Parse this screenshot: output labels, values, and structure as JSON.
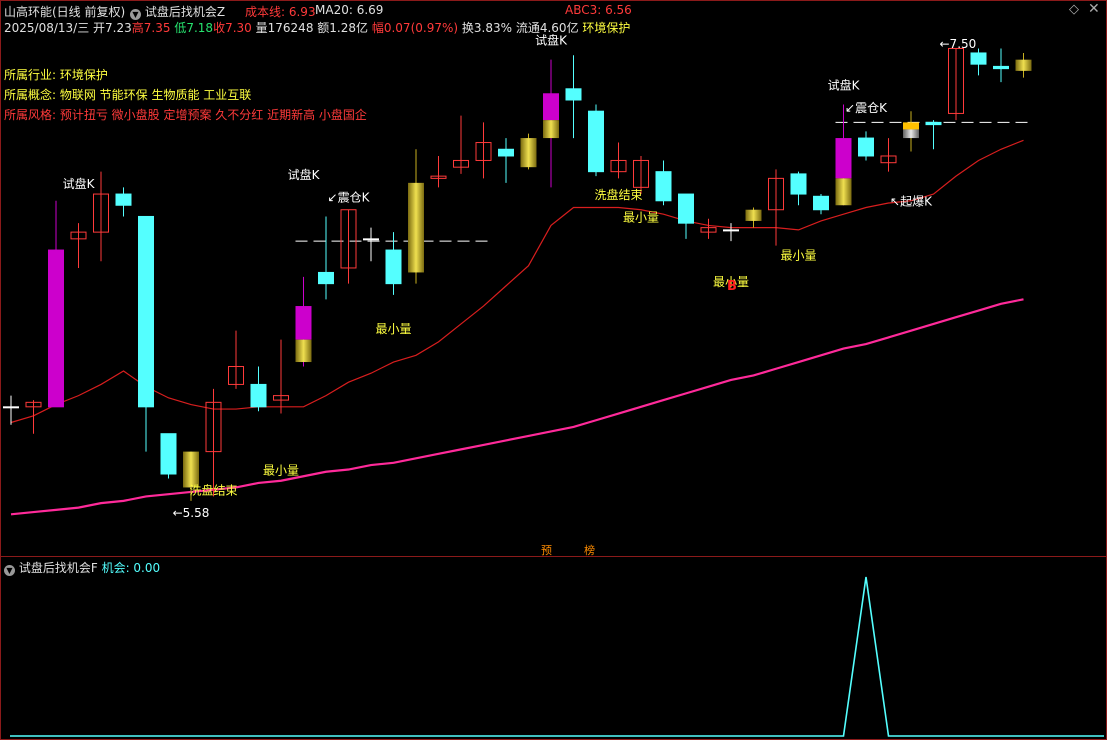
{
  "header": {
    "stock_title": "山高环能(日线 前复权)",
    "indicator_title": "试盘后找机会Z",
    "cost_line": "成本线: 6.93",
    "ma20": "MA20: 6.69",
    "abc3": "ABC3: 6.56",
    "date": "2025/08/13/三",
    "open": "开7.23",
    "high": "高7.35",
    "low": "低7.18",
    "close": "收7.30",
    "volume": "量176248",
    "amount": "额1.28亿",
    "change": "幅0.07(0.97%)",
    "turnover": "换3.83%",
    "float": "流通4.60亿",
    "sector": "环境保护"
  },
  "info": {
    "industry": "所属行业: 环境保护",
    "concept": "所属概念: 物联网 节能环保 生物质能 工业互联",
    "style": "所属风格: 预计扭亏 微小盘股 定增预案 久不分红 近期新高 小盘国企"
  },
  "bottom_badges": [
    "预",
    "榜"
  ],
  "sub_panel": {
    "title": "试盘后找机会F",
    "value": "机会: 0.00"
  },
  "colors": {
    "up": "#ff3a3a",
    "down": "#54ffff",
    "trial": "#cc00cc",
    "gold": "#d4c030",
    "ma": "#d81e1e",
    "long_ma": "#ff2a9a",
    "text_red": "#ff3a3a",
    "text_green": "#26e26e",
    "text_yellow": "#ffff40",
    "text_cyan": "#54ffff"
  },
  "chart_data": {
    "type": "candlestick",
    "price_range": [
      5.45,
      7.62
    ],
    "candles": [
      {
        "o": 6.0,
        "c": 6.0,
        "h": 6.05,
        "l": 5.92,
        "k": "doji"
      },
      {
        "o": 6.0,
        "c": 6.02,
        "h": 6.03,
        "l": 5.88,
        "k": "up"
      },
      {
        "o": 6.0,
        "c": 6.7,
        "h": 6.92,
        "l": 6.0,
        "k": "trial"
      },
      {
        "o": 6.75,
        "c": 6.78,
        "h": 6.82,
        "l": 6.62,
        "k": "up"
      },
      {
        "o": 6.78,
        "c": 6.95,
        "h": 7.05,
        "l": 6.65,
        "k": "up"
      },
      {
        "o": 6.95,
        "c": 6.9,
        "h": 6.98,
        "l": 6.85,
        "k": "down"
      },
      {
        "o": 6.85,
        "c": 6.0,
        "h": 6.85,
        "l": 5.8,
        "k": "down"
      },
      {
        "o": 5.88,
        "c": 5.7,
        "h": 5.88,
        "l": 5.68,
        "k": "down"
      },
      {
        "o": 5.64,
        "c": 5.8,
        "h": 5.8,
        "l": 5.58,
        "k": "gold"
      },
      {
        "o": 5.8,
        "c": 6.02,
        "h": 6.08,
        "l": 5.6,
        "k": "up"
      },
      {
        "o": 6.1,
        "c": 6.18,
        "h": 6.34,
        "l": 6.08,
        "k": "up"
      },
      {
        "o": 6.1,
        "c": 6.0,
        "h": 6.18,
        "l": 5.98,
        "k": "down"
      },
      {
        "o": 6.03,
        "c": 6.05,
        "h": 6.3,
        "l": 5.97,
        "k": "up"
      },
      {
        "o": 6.2,
        "c": 6.45,
        "h": 6.58,
        "l": 6.18,
        "k": "trial"
      },
      {
        "o": 6.6,
        "c": 6.55,
        "h": 6.85,
        "l": 6.48,
        "k": "down"
      },
      {
        "o": 6.62,
        "c": 6.88,
        "h": 6.88,
        "l": 6.55,
        "k": "up"
      },
      {
        "o": 6.75,
        "c": 6.75,
        "h": 6.8,
        "l": 6.65,
        "k": "doji"
      },
      {
        "o": 6.7,
        "c": 6.55,
        "h": 6.78,
        "l": 6.5,
        "k": "down"
      },
      {
        "o": 6.6,
        "c": 7.0,
        "h": 7.15,
        "l": 6.55,
        "k": "gold"
      },
      {
        "o": 7.02,
        "c": 7.03,
        "h": 7.12,
        "l": 6.98,
        "k": "up"
      },
      {
        "o": 7.07,
        "c": 7.1,
        "h": 7.3,
        "l": 7.04,
        "k": "up"
      },
      {
        "o": 7.1,
        "c": 7.18,
        "h": 7.27,
        "l": 7.02,
        "k": "up"
      },
      {
        "o": 7.15,
        "c": 7.12,
        "h": 7.2,
        "l": 7.0,
        "k": "down"
      },
      {
        "o": 7.07,
        "c": 7.2,
        "h": 7.22,
        "l": 7.06,
        "k": "gold"
      },
      {
        "o": 7.2,
        "c": 7.4,
        "h": 7.55,
        "l": 6.98,
        "k": "trial"
      },
      {
        "o": 7.42,
        "c": 7.37,
        "h": 7.57,
        "l": 7.2,
        "k": "down"
      },
      {
        "o": 7.32,
        "c": 7.05,
        "h": 7.35,
        "l": 7.03,
        "k": "down"
      },
      {
        "o": 7.05,
        "c": 7.1,
        "h": 7.18,
        "l": 7.02,
        "k": "up"
      },
      {
        "o": 6.98,
        "c": 7.1,
        "h": 7.12,
        "l": 6.95,
        "k": "up"
      },
      {
        "o": 7.05,
        "c": 6.92,
        "h": 7.1,
        "l": 6.9,
        "k": "down"
      },
      {
        "o": 6.95,
        "c": 6.82,
        "h": 6.95,
        "l": 6.75,
        "k": "down"
      },
      {
        "o": 6.78,
        "c": 6.8,
        "h": 6.84,
        "l": 6.75,
        "k": "up"
      },
      {
        "o": 6.79,
        "c": 6.79,
        "h": 6.82,
        "l": 6.74,
        "k": "doji"
      },
      {
        "o": 6.83,
        "c": 6.88,
        "h": 6.89,
        "l": 6.8,
        "k": "gold"
      },
      {
        "o": 6.88,
        "c": 7.02,
        "h": 7.06,
        "l": 6.72,
        "k": "up"
      },
      {
        "o": 7.04,
        "c": 6.95,
        "h": 7.05,
        "l": 6.9,
        "k": "down"
      },
      {
        "o": 6.94,
        "c": 6.88,
        "h": 6.95,
        "l": 6.86,
        "k": "down"
      },
      {
        "o": 6.9,
        "c": 7.2,
        "h": 7.35,
        "l": 6.9,
        "k": "trial"
      },
      {
        "o": 7.2,
        "c": 7.12,
        "h": 7.23,
        "l": 7.1,
        "k": "down"
      },
      {
        "o": 7.09,
        "c": 7.12,
        "h": 7.2,
        "l": 7.05,
        "k": "up"
      },
      {
        "o": 7.27,
        "c": 7.2,
        "h": 7.32,
        "l": 7.14,
        "k": "gold2"
      },
      {
        "o": 7.27,
        "c": 7.26,
        "h": 7.28,
        "l": 7.15,
        "k": "down"
      },
      {
        "o": 7.31,
        "c": 7.6,
        "h": 7.6,
        "l": 7.28,
        "k": "up"
      },
      {
        "o": 7.58,
        "c": 7.53,
        "h": 7.6,
        "l": 7.48,
        "k": "down"
      },
      {
        "o": 7.52,
        "c": 7.51,
        "h": 7.6,
        "l": 7.45,
        "k": "down"
      },
      {
        "o": 7.5,
        "c": 7.55,
        "h": 7.58,
        "l": 7.47,
        "k": "gold"
      }
    ],
    "ma_values": [
      5.93,
      5.96,
      6.01,
      6.05,
      6.1,
      6.16,
      6.09,
      6.04,
      6.01,
      5.99,
      5.99,
      6.0,
      6.0,
      6.0,
      6.05,
      6.11,
      6.15,
      6.2,
      6.23,
      6.29,
      6.37,
      6.45,
      6.54,
      6.63,
      6.81,
      6.89,
      6.89,
      6.89,
      6.88,
      6.86,
      6.83,
      6.81,
      6.8,
      6.8,
      6.8,
      6.79,
      6.83,
      6.86,
      6.89,
      6.91,
      6.92,
      6.95,
      7.03,
      7.1,
      7.15,
      7.19
    ],
    "long_ma_values": [
      5.52,
      5.53,
      5.54,
      5.55,
      5.57,
      5.58,
      5.6,
      5.61,
      5.62,
      5.63,
      5.64,
      5.66,
      5.67,
      5.69,
      5.71,
      5.72,
      5.74,
      5.75,
      5.77,
      5.79,
      5.81,
      5.83,
      5.85,
      5.87,
      5.89,
      5.91,
      5.94,
      5.97,
      6.0,
      6.03,
      6.06,
      6.09,
      6.12,
      6.14,
      6.17,
      6.2,
      6.23,
      6.26,
      6.28,
      6.31,
      6.34,
      6.37,
      6.4,
      6.43,
      6.46,
      6.48
    ],
    "dashed_levels": [
      {
        "from": 13,
        "to": 21,
        "price": 6.74
      },
      {
        "from": 37,
        "to": 45,
        "price": 7.27
      }
    ],
    "labels": [
      {
        "i": 3,
        "text": "试盘K",
        "price": 6.95,
        "pos": "above",
        "color": "#ffffff"
      },
      {
        "i": 13,
        "text": "试盘K",
        "price": 6.99,
        "pos": "above",
        "color": "#ffffff"
      },
      {
        "i": 24,
        "text": "试盘K",
        "price": 7.59,
        "pos": "above",
        "color": "#ffffff"
      },
      {
        "i": 37,
        "text": "试盘K",
        "price": 7.39,
        "pos": "above",
        "color": "#ffffff"
      },
      {
        "i": 15,
        "text": "↙震仓K",
        "price": 6.89,
        "pos": "above",
        "color": "#ffffff"
      },
      {
        "i": 38,
        "text": "↙震仓K",
        "price": 7.29,
        "pos": "above",
        "color": "#ffffff"
      },
      {
        "i": 40,
        "text": "↖起爆K",
        "price": 6.97,
        "pos": "below",
        "color": "#ffffff"
      },
      {
        "i": 9,
        "text": "洗盘结束",
        "price": 5.68,
        "pos": "below",
        "color": "#ffff40"
      },
      {
        "i": 27,
        "text": "洗盘结束",
        "price": 7.0,
        "pos": "below",
        "color": "#ffff40"
      },
      {
        "i": 12,
        "text": "最小量",
        "price": 5.77,
        "pos": "below",
        "color": "#ffff40"
      },
      {
        "i": 17,
        "text": "最小量",
        "price": 6.4,
        "pos": "below",
        "color": "#ffff40"
      },
      {
        "i": 28,
        "text": "最小量",
        "price": 6.9,
        "pos": "below",
        "color": "#ffff40"
      },
      {
        "i": 32,
        "text": "最小量",
        "price": 6.61,
        "pos": "below",
        "color": "#ffff40"
      },
      {
        "i": 35,
        "text": "最小量",
        "price": 6.73,
        "pos": "below",
        "color": "#ffff40"
      },
      {
        "i": 8,
        "text": "←5.58",
        "price": 5.58,
        "pos": "below",
        "color": "#ffffff"
      },
      {
        "i": 41,
        "text": "←7.50",
        "price": 7.62,
        "pos": "right",
        "color": "#ffffff"
      }
    ],
    "marker": {
      "i": 32,
      "text": "B",
      "color": "#ff2020"
    },
    "sub_chart": {
      "type": "line",
      "values": [
        0,
        0,
        0,
        0,
        0,
        0,
        0,
        0,
        0,
        0,
        0,
        0,
        0,
        0,
        0,
        0,
        0,
        0,
        0,
        0,
        0,
        0,
        0,
        0,
        0,
        0,
        0,
        0,
        0,
        0,
        0,
        0,
        0,
        0,
        0,
        0,
        0,
        0,
        1,
        0,
        0,
        0,
        0,
        0,
        0,
        0
      ],
      "ylim": [
        0,
        1
      ]
    }
  }
}
